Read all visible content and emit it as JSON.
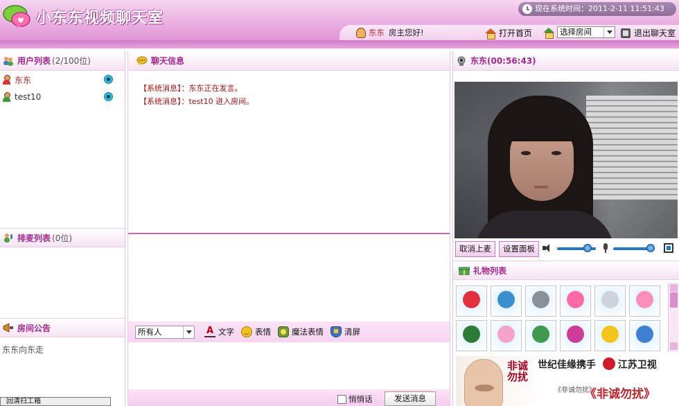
{
  "header": {
    "title": "小东东视频聊天室",
    "clock_label": "现在系统时间：",
    "clock_value": "2011-2-11 11:51:43"
  },
  "toolbar": {
    "username": "东东",
    "greeting": "房主您好!",
    "home_label": "打开首页",
    "room_select_value": "选择房间",
    "exit_label": "退出聊天室"
  },
  "user_list": {
    "title": "用户列表",
    "count": "(2/100位)",
    "users": [
      {
        "name": "东东",
        "color": "#c7282a"
      },
      {
        "name": "test10",
        "color": "#333333"
      }
    ]
  },
  "mic_queue": {
    "title": "排麦列表",
    "count": "(0位)"
  },
  "room_notice": {
    "title": "房间公告",
    "text": "东东向东走"
  },
  "left_bottom_bar": {
    "text": "回清扫工箱"
  },
  "chat": {
    "title": "聊天信息",
    "messages": [
      "【系统消息】：东东正在发言。",
      "【系统消息】：test10 进入房间。"
    ],
    "recipient_value": "所有人",
    "tools": [
      "文字",
      "表情",
      "魔法表情",
      "清屏"
    ],
    "whisper_label": "悄悄话",
    "send_label": "发送消息"
  },
  "video": {
    "title": "东东(00:56:43)",
    "cancel_mic_label": "取消上麦",
    "settings_label": "设置面板",
    "speaker_volume": 0.78,
    "mic_volume": 0.9
  },
  "gifts": {
    "title": "礼物列表",
    "items": [
      {
        "icon": "rose-gift-icon",
        "color": "#e2303e"
      },
      {
        "icon": "castle-gift-icon",
        "color": "#3a8fd0"
      },
      {
        "icon": "spaceship-gift-icon",
        "color": "#8b8f98"
      },
      {
        "icon": "cloud-heart-gift-icon",
        "color": "#ff6aa6"
      },
      {
        "icon": "ring-gift-icon",
        "color": "#cdd2db"
      },
      {
        "icon": "heart-gift-icon",
        "color": "#ff8fb8"
      },
      {
        "icon": "motorbike-gift-icon",
        "color": "#2e7a37"
      },
      {
        "icon": "icecream-gift-icon",
        "color": "#f6a3c8"
      },
      {
        "icon": "money-gift-icon",
        "color": "#3f9a4d"
      },
      {
        "icon": "lipstick-gift-icon",
        "color": "#cc3d9a"
      },
      {
        "icon": "car-gift-icon",
        "color": "#f3c51a"
      },
      {
        "icon": "drink-gift-icon",
        "color": "#3f7fd4"
      }
    ]
  },
  "ad": {
    "calligraphy": "非诚勿扰",
    "line1_a": "世纪佳缘携手",
    "line1_b": "江苏卫视",
    "line2": "《非诚勿扰》",
    "line3": "《非诚勿扰》"
  }
}
